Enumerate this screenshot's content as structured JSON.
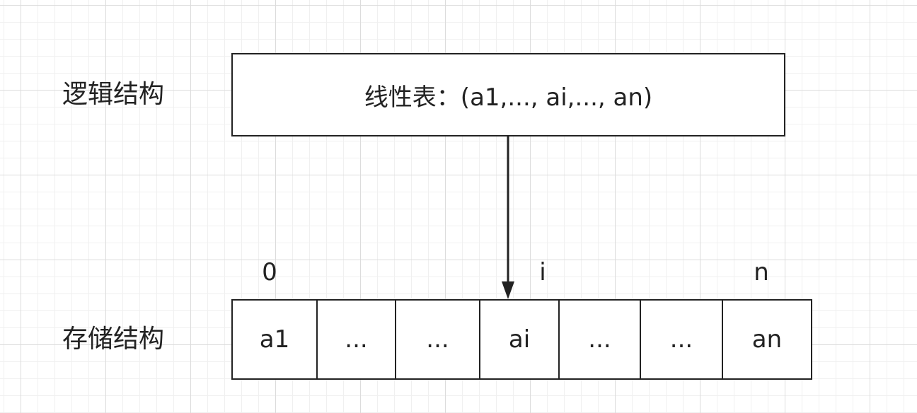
{
  "labels": {
    "logical": "逻辑结构",
    "storage": "存储结构"
  },
  "logical_box": {
    "text": "线性表：(a1,..., ai,..., an)"
  },
  "indices": {
    "first": "0",
    "middle": "i",
    "last": "n"
  },
  "array_cells": [
    "a1",
    "...",
    "...",
    "ai",
    "...",
    "...",
    "an"
  ],
  "colors": {
    "stroke": "#222222",
    "background": "#ffffff",
    "grid": "#dcdcdc"
  }
}
